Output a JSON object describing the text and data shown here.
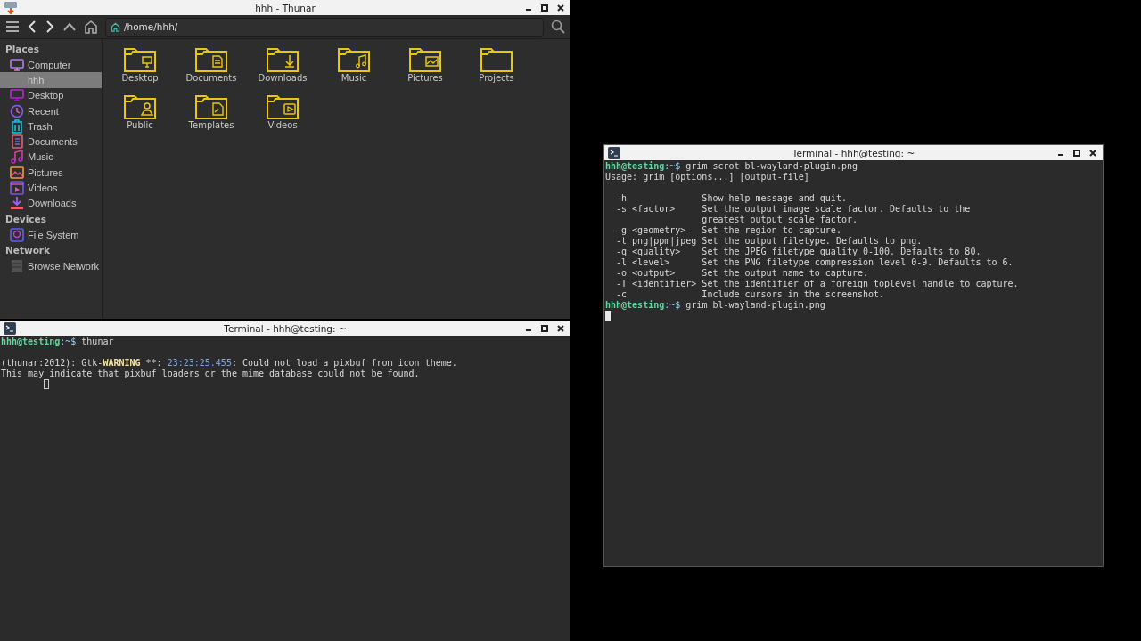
{
  "thunar": {
    "title": "hhh - Thunar",
    "path": "/home/hhh/",
    "sidebar": [
      {
        "heading": "Places",
        "items": [
          {
            "label": "Computer",
            "kind": "computer",
            "selected": false
          },
          {
            "label": "hhh",
            "selected": true
          },
          {
            "label": "Desktop",
            "kind": "desktop",
            "selected": false
          },
          {
            "label": "Recent",
            "kind": "recent",
            "selected": false
          },
          {
            "label": "Trash",
            "kind": "trash",
            "selected": false
          },
          {
            "label": "Documents",
            "kind": "documents",
            "selected": false
          },
          {
            "label": "Music",
            "kind": "music",
            "selected": false
          },
          {
            "label": "Pictures",
            "kind": "pictures",
            "selected": false
          },
          {
            "label": "Videos",
            "kind": "videos",
            "selected": false
          },
          {
            "label": "Downloads",
            "kind": "downloads",
            "selected": false
          }
        ]
      },
      {
        "heading": "Devices",
        "items": [
          {
            "label": "File System",
            "kind": "drive",
            "selected": false
          }
        ]
      },
      {
        "heading": "Network",
        "items": [
          {
            "label": "Browse Network",
            "kind": "network",
            "selected": false
          }
        ]
      }
    ],
    "folders": [
      {
        "name": "Desktop",
        "kind": "desktop"
      },
      {
        "name": "Documents",
        "kind": "documents"
      },
      {
        "name": "Downloads",
        "kind": "downloads"
      },
      {
        "name": "Music",
        "kind": "music"
      },
      {
        "name": "Pictures",
        "kind": "pictures"
      },
      {
        "name": "Projects",
        "kind": "plain"
      },
      {
        "name": "Public",
        "kind": "public"
      },
      {
        "name": "Templates",
        "kind": "templates"
      },
      {
        "name": "Videos",
        "kind": "videos"
      }
    ]
  },
  "terminals": [
    {
      "title": "Terminal - hhh@testing: ~",
      "focused": false,
      "lines": [
        {
          "kind": "text",
          "segments": [
            {
              "text": "hhh@testing",
              "kind": "host"
            },
            {
              "text": ":~$ ",
              "kind": "path"
            },
            {
              "text": "thunar",
              "kind": "plain"
            }
          ]
        },
        {
          "kind": "blank"
        },
        {
          "kind": "text",
          "segments": [
            {
              "text": "(thunar:2012): Gtk-",
              "kind": "plain"
            },
            {
              "text": "WARNING",
              "kind": "warning"
            },
            {
              "text": " **: ",
              "kind": "plain"
            },
            {
              "text": "23:23:25.455",
              "kind": "time"
            },
            {
              "text": ": Could not load a pixbuf from icon theme.",
              "kind": "plain"
            }
          ]
        },
        {
          "kind": "text",
          "segments": [
            {
              "text": "This may indicate that pixbuf loaders or the mime database could not be found.",
              "kind": "plain"
            }
          ]
        }
      ]
    },
    {
      "title": "Terminal - hhh@testing: ~",
      "focused": true,
      "lines": [
        {
          "kind": "text",
          "segments": [
            {
              "text": "hhh@testing",
              "kind": "host"
            },
            {
              "text": ":~$ ",
              "kind": "path"
            },
            {
              "text": "grim scrot bl-wayland-plugin.png",
              "kind": "plain"
            }
          ]
        },
        {
          "kind": "text",
          "segments": [
            {
              "text": "Usage: grim [options...] [output-file]",
              "kind": "plain"
            }
          ]
        },
        {
          "kind": "blank"
        },
        {
          "kind": "text",
          "segments": [
            {
              "text": "  -h              Show help message and quit.",
              "kind": "plain"
            }
          ]
        },
        {
          "kind": "text",
          "segments": [
            {
              "text": "  -s <factor>     Set the output image scale factor. Defaults to the",
              "kind": "plain"
            }
          ]
        },
        {
          "kind": "text",
          "segments": [
            {
              "text": "                  greatest output scale factor.",
              "kind": "plain"
            }
          ]
        },
        {
          "kind": "text",
          "segments": [
            {
              "text": "  -g <geometry>   Set the region to capture.",
              "kind": "plain"
            }
          ]
        },
        {
          "kind": "text",
          "segments": [
            {
              "text": "  -t png|ppm|jpeg Set the output filetype. Defaults to png.",
              "kind": "plain"
            }
          ]
        },
        {
          "kind": "text",
          "segments": [
            {
              "text": "  -q <quality>    Set the JPEG filetype quality 0-100. Defaults to 80.",
              "kind": "plain"
            }
          ]
        },
        {
          "kind": "text",
          "segments": [
            {
              "text": "  -l <level>      Set the PNG filetype compression level 0-9. Defaults to 6.",
              "kind": "plain"
            }
          ]
        },
        {
          "kind": "text",
          "segments": [
            {
              "text": "  -o <output>     Set the output name to capture.",
              "kind": "plain"
            }
          ]
        },
        {
          "kind": "text",
          "segments": [
            {
              "text": "  -T <identifier> Set the identifier of a foreign toplevel handle to capture.",
              "kind": "plain"
            }
          ]
        },
        {
          "kind": "text",
          "segments": [
            {
              "text": "  -c              Include cursors in the screenshot.",
              "kind": "plain"
            }
          ]
        },
        {
          "kind": "text",
          "segments": [
            {
              "text": "hhh@testing",
              "kind": "host"
            },
            {
              "text": ":~$ ",
              "kind": "path"
            },
            {
              "text": "grim bl-wayland-plugin.png",
              "kind": "plain"
            }
          ]
        }
      ]
    }
  ]
}
